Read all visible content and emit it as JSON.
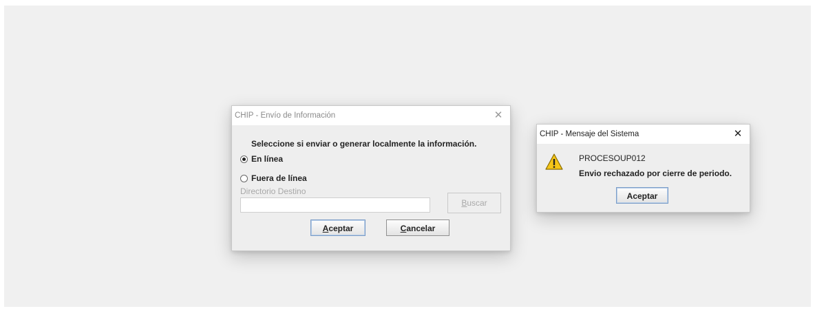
{
  "envio_dialog": {
    "title": "CHIP - Envío de Información",
    "close_glyph": "✕",
    "prompt": "Seleccione si enviar o generar localmente la información.",
    "options": [
      {
        "label": "En línea",
        "selected": true
      },
      {
        "label": "Fuera de línea",
        "selected": false
      }
    ],
    "directory_label": "Directorio Destino",
    "directory_value": "",
    "browse_button": {
      "mnemonic": "B",
      "rest": "uscar",
      "enabled": false
    },
    "accept_button": {
      "mnemonic": "A",
      "rest": "ceptar"
    },
    "cancel_button": {
      "mnemonic": "C",
      "rest": "ancelar"
    }
  },
  "message_dialog": {
    "title": "CHIP - Mensaje del Sistema",
    "close_glyph": "✕",
    "icon": "warning-icon",
    "code": "PROCESOUP012",
    "message": "Envio rechazado por cierre de periodo.",
    "accept_label": "Aceptar"
  },
  "colors": {
    "desktop": "#f0f0f0",
    "dialog_body": "#eeeeee",
    "warning_fill": "#f5c518"
  }
}
